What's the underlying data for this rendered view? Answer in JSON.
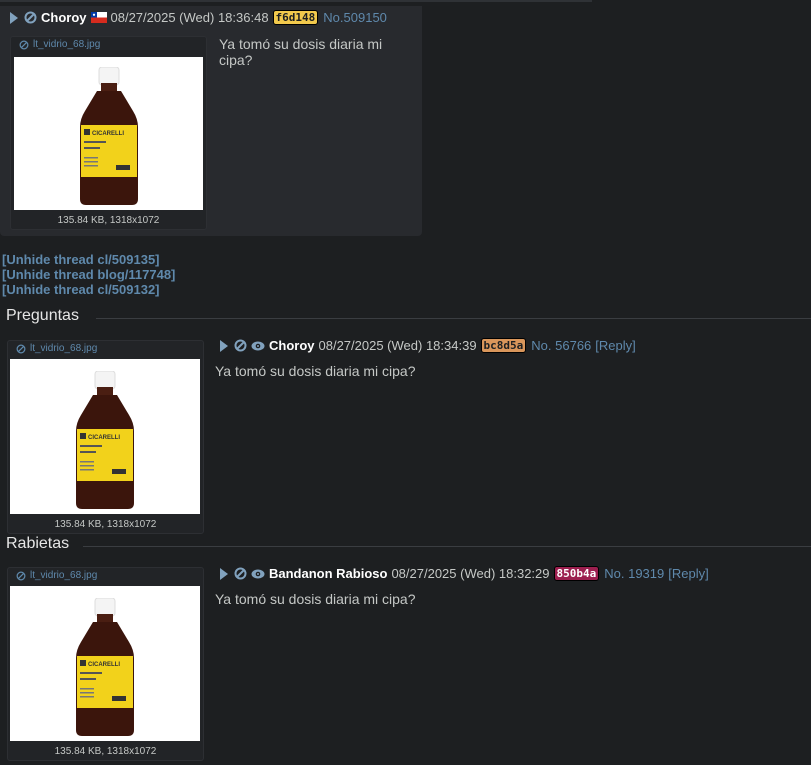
{
  "colors": {
    "background": "#1d1f21",
    "post": "#282a2e",
    "link": "#5f89ac",
    "name": "#ffffff",
    "text": "#c5c8c6"
  },
  "post1": {
    "name": "Choroy",
    "flag_icon": "chile-flag-icon",
    "date": "08/27/2025 (Wed) 18:36:48",
    "uid": "f6d148",
    "uid_color": "#f2c94c",
    "number": "No.509150",
    "filename": "lt_vidrio_68.jpg",
    "fileinfo": "135.84 KB, 1318x1072",
    "message_line1": "Ya tomó su dosis diaria mi",
    "message_line2": "cipa?"
  },
  "unhide": [
    "[Unhide thread cl/509135]",
    "[Unhide thread blog/117748]",
    "[Unhide thread cl/509132]"
  ],
  "sections": [
    {
      "title": "Preguntas",
      "name": "Choroy",
      "date": "08/27/2025 (Wed) 18:34:39",
      "uid": "bc8d5a",
      "uid_color": "#d9965b",
      "number": "No. 56766",
      "reply": "[Reply]",
      "filename": "lt_vidrio_68.jpg",
      "fileinfo": "135.84 KB, 1318x1072",
      "message": "Ya tomó su dosis diaria mi cipa?"
    },
    {
      "title": "Rabietas",
      "name": "Bandanon Rabioso",
      "date": "08/27/2025 (Wed) 18:32:29",
      "uid": "850b4a",
      "uid_color": "#9c1f4f",
      "number": "No. 19319",
      "reply": "[Reply]",
      "filename": "lt_vidrio_68.jpg",
      "fileinfo": "135.84 KB, 1318x1072",
      "message": "Ya tomó su dosis diaria mi cipa?"
    }
  ],
  "bottle_label": "CICARELLI"
}
